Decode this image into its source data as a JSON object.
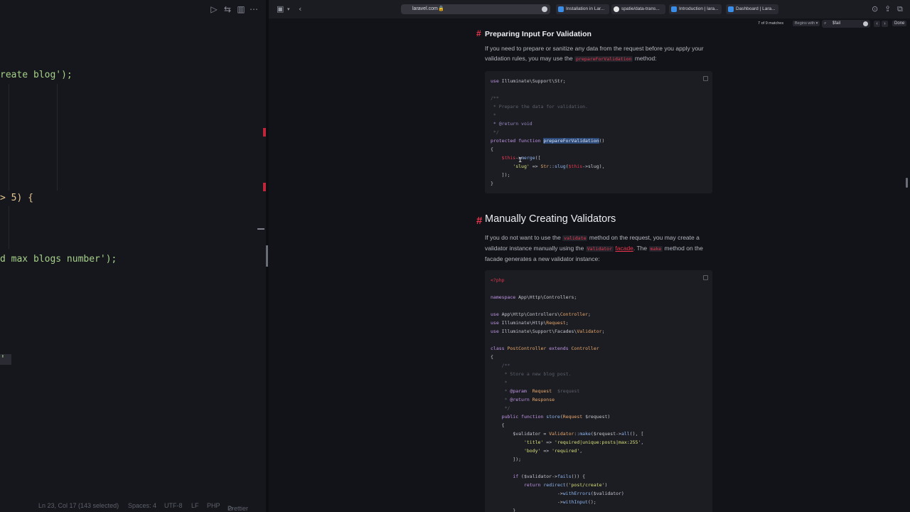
{
  "editor": {
    "code_lines": [
      {
        "text": "reate blog');",
        "kind": "call"
      },
      {
        "text": "> 5) {",
        "kind": "cond"
      },
      {
        "text": "d max blogs number');",
        "kind": "call"
      },
      {
        "text": "'",
        "kind": "quote"
      }
    ],
    "status": {
      "position": "Ln 23, Col 17 (143 selected)",
      "spaces": "Spaces: 4",
      "encoding": "UTF-8",
      "eol": "LF",
      "language": "PHP",
      "formatter": "Prettier"
    }
  },
  "browser": {
    "url": "laravel.com",
    "tabs": [
      {
        "label": "Installation in Lar...",
        "icon": "square-favicon"
      },
      {
        "label": "spatie/data-trans...",
        "icon": "github-favicon"
      },
      {
        "label": "Introduction | lara...",
        "icon": "square-favicon"
      },
      {
        "label": "Dashboard | Lara...",
        "icon": "square-favicon"
      }
    ],
    "find": {
      "count": "7 of 9 matches",
      "mode": "Begins with",
      "query": "$fail",
      "done": "Done"
    }
  },
  "doc": {
    "section1": {
      "hash": "#",
      "title": "Preparing Input For Validation",
      "para_a": "If you need to prepare or sanitize any data from the request before you apply your validation rules, you may use the",
      "para_code": "prepareForValidation",
      "para_b": "method:"
    },
    "code1": [
      "use Illuminate\\Support\\Str;",
      "",
      "/**",
      " * Prepare the data for validation.",
      " *",
      " * @return void",
      " */",
      "protected function prepareForValidation()",
      "{",
      "    $this->merge([",
      "        'slug' => Str::slug($this->slug),",
      "    ]);",
      "}"
    ],
    "section2": {
      "hash": "#",
      "title": "Manually Creating Validators",
      "p1": "If you do not want to use the",
      "c1": "validate",
      "p2": "method on the request, you may create a validator instance manually using the",
      "c2": "Validator",
      "link": "facade",
      "p3": ". The",
      "c3": "make",
      "p4": "method on the facade generates a new validator instance:"
    },
    "code2": [
      "<?php",
      "",
      "namespace App\\Http\\Controllers;",
      "",
      "use App\\Http\\Controllers\\Controller;",
      "use Illuminate\\Http\\Request;",
      "use Illuminate\\Support\\Facades\\Validator;",
      "",
      "class PostController extends Controller",
      "{",
      "    /**",
      "     * Store a new blog post.",
      "     *",
      "     * @param  Request  $request",
      "     * @return Response",
      "     */",
      "    public function store(Request $request)",
      "    {",
      "        $validator = Validator::make($request->all(), [",
      "            'title' => 'required|unique:posts|max:255',",
      "            'body' => 'required',",
      "        ]);",
      "",
      "        if ($validator->fails()) {",
      "            return redirect('post/create')",
      "                        ->withErrors($validator)",
      "                        ->withInput();",
      "        }"
    ]
  }
}
